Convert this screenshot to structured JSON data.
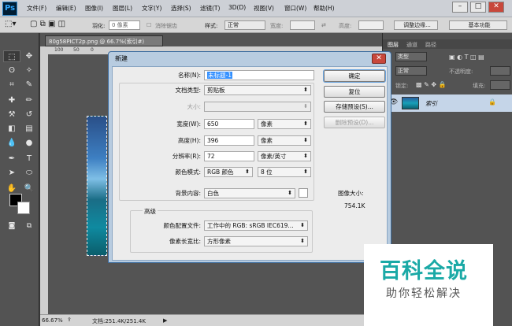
{
  "app": {
    "logo": "Ps"
  },
  "menu": [
    "文件(F)",
    "编辑(E)",
    "图像(I)",
    "图层(L)",
    "文字(Y)",
    "选择(S)",
    "滤镜(T)",
    "3D(D)",
    "视图(V)",
    "窗口(W)",
    "帮助(H)"
  ],
  "window_controls": {
    "minimize": "–",
    "maximize": "□",
    "close": "✕"
  },
  "options": {
    "feather_label": "羽化:",
    "feather_value": "0 像素",
    "antialias_label": "消除锯齿",
    "style_label": "样式:",
    "style_value": "正常",
    "width_label": "宽度:",
    "height_label": "高度:",
    "refine_button": "调整边缘...",
    "workspace": "基本功能"
  },
  "document": {
    "tab_title": "80g58PICT2p.png @ 66.7%(索引#)",
    "ruler_marks": [
      "100",
      "50",
      "0"
    ],
    "zoom": "66.67%",
    "doc_info": "文档:251.4K/251.4K"
  },
  "panel": {
    "tabs": [
      "图层",
      "通道",
      "路径"
    ],
    "kind_label": "类型",
    "blend_mode": "正常",
    "opacity_label": "不透明度:",
    "lock_label": "锁定:",
    "fill_label": "填充:",
    "layer_name": "索引"
  },
  "dialog": {
    "title": "新建",
    "name_label": "名称(N):",
    "name_value": "未标题-1",
    "preset_label": "文档类型:",
    "preset_value": "剪贴板",
    "size_label": "大小:",
    "width_label": "宽度(W):",
    "width_value": "650",
    "width_unit": "像素",
    "height_label": "高度(H):",
    "height_value": "396",
    "height_unit": "像素",
    "resolution_label": "分辨率(R):",
    "resolution_value": "72",
    "resolution_unit": "像素/英寸",
    "color_mode_label": "颜色模式:",
    "color_mode_value": "RGB 颜色",
    "bit_depth": "8 位",
    "background_label": "背景内容:",
    "background_value": "白色",
    "advanced_label": "高级",
    "profile_label": "颜色配置文件:",
    "profile_value": "工作中的 RGB: sRGB IEC619...",
    "pixel_aspect_label": "像素长宽比:",
    "pixel_aspect_value": "方形像素",
    "ok_button": "确定",
    "reset_button": "复位",
    "save_preset_button": "存储预设(S)...",
    "delete_preset_button": "删除预设(D)...",
    "image_size_label": "图像大小:",
    "image_size_value": "754.1K"
  },
  "watermark": {
    "title": "百科全说",
    "subtitle": "助你轻松解决"
  }
}
